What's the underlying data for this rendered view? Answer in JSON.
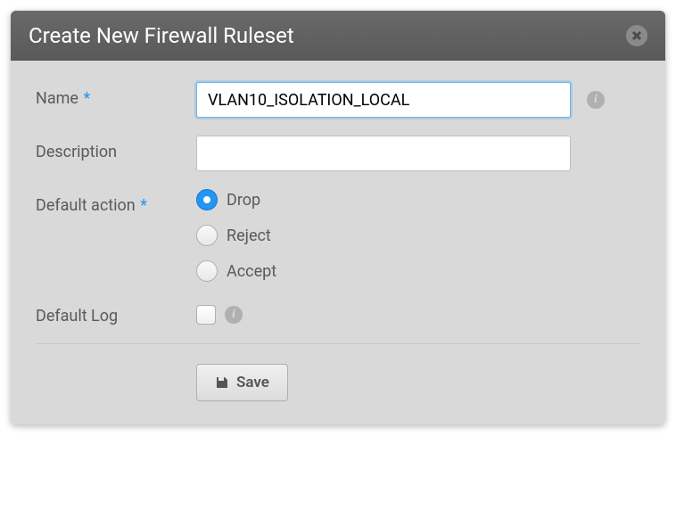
{
  "header": {
    "title": "Create New Firewall Ruleset"
  },
  "form": {
    "name": {
      "label": "Name",
      "required_mark": "*",
      "value": "VLAN10_ISOLATION_LOCAL"
    },
    "description": {
      "label": "Description",
      "value": ""
    },
    "default_action": {
      "label": "Default action",
      "required_mark": "*",
      "options": [
        {
          "label": "Drop",
          "checked": true
        },
        {
          "label": "Reject",
          "checked": false
        },
        {
          "label": "Accept",
          "checked": false
        }
      ]
    },
    "default_log": {
      "label": "Default Log",
      "checked": false
    }
  },
  "buttons": {
    "save_label": "Save"
  }
}
